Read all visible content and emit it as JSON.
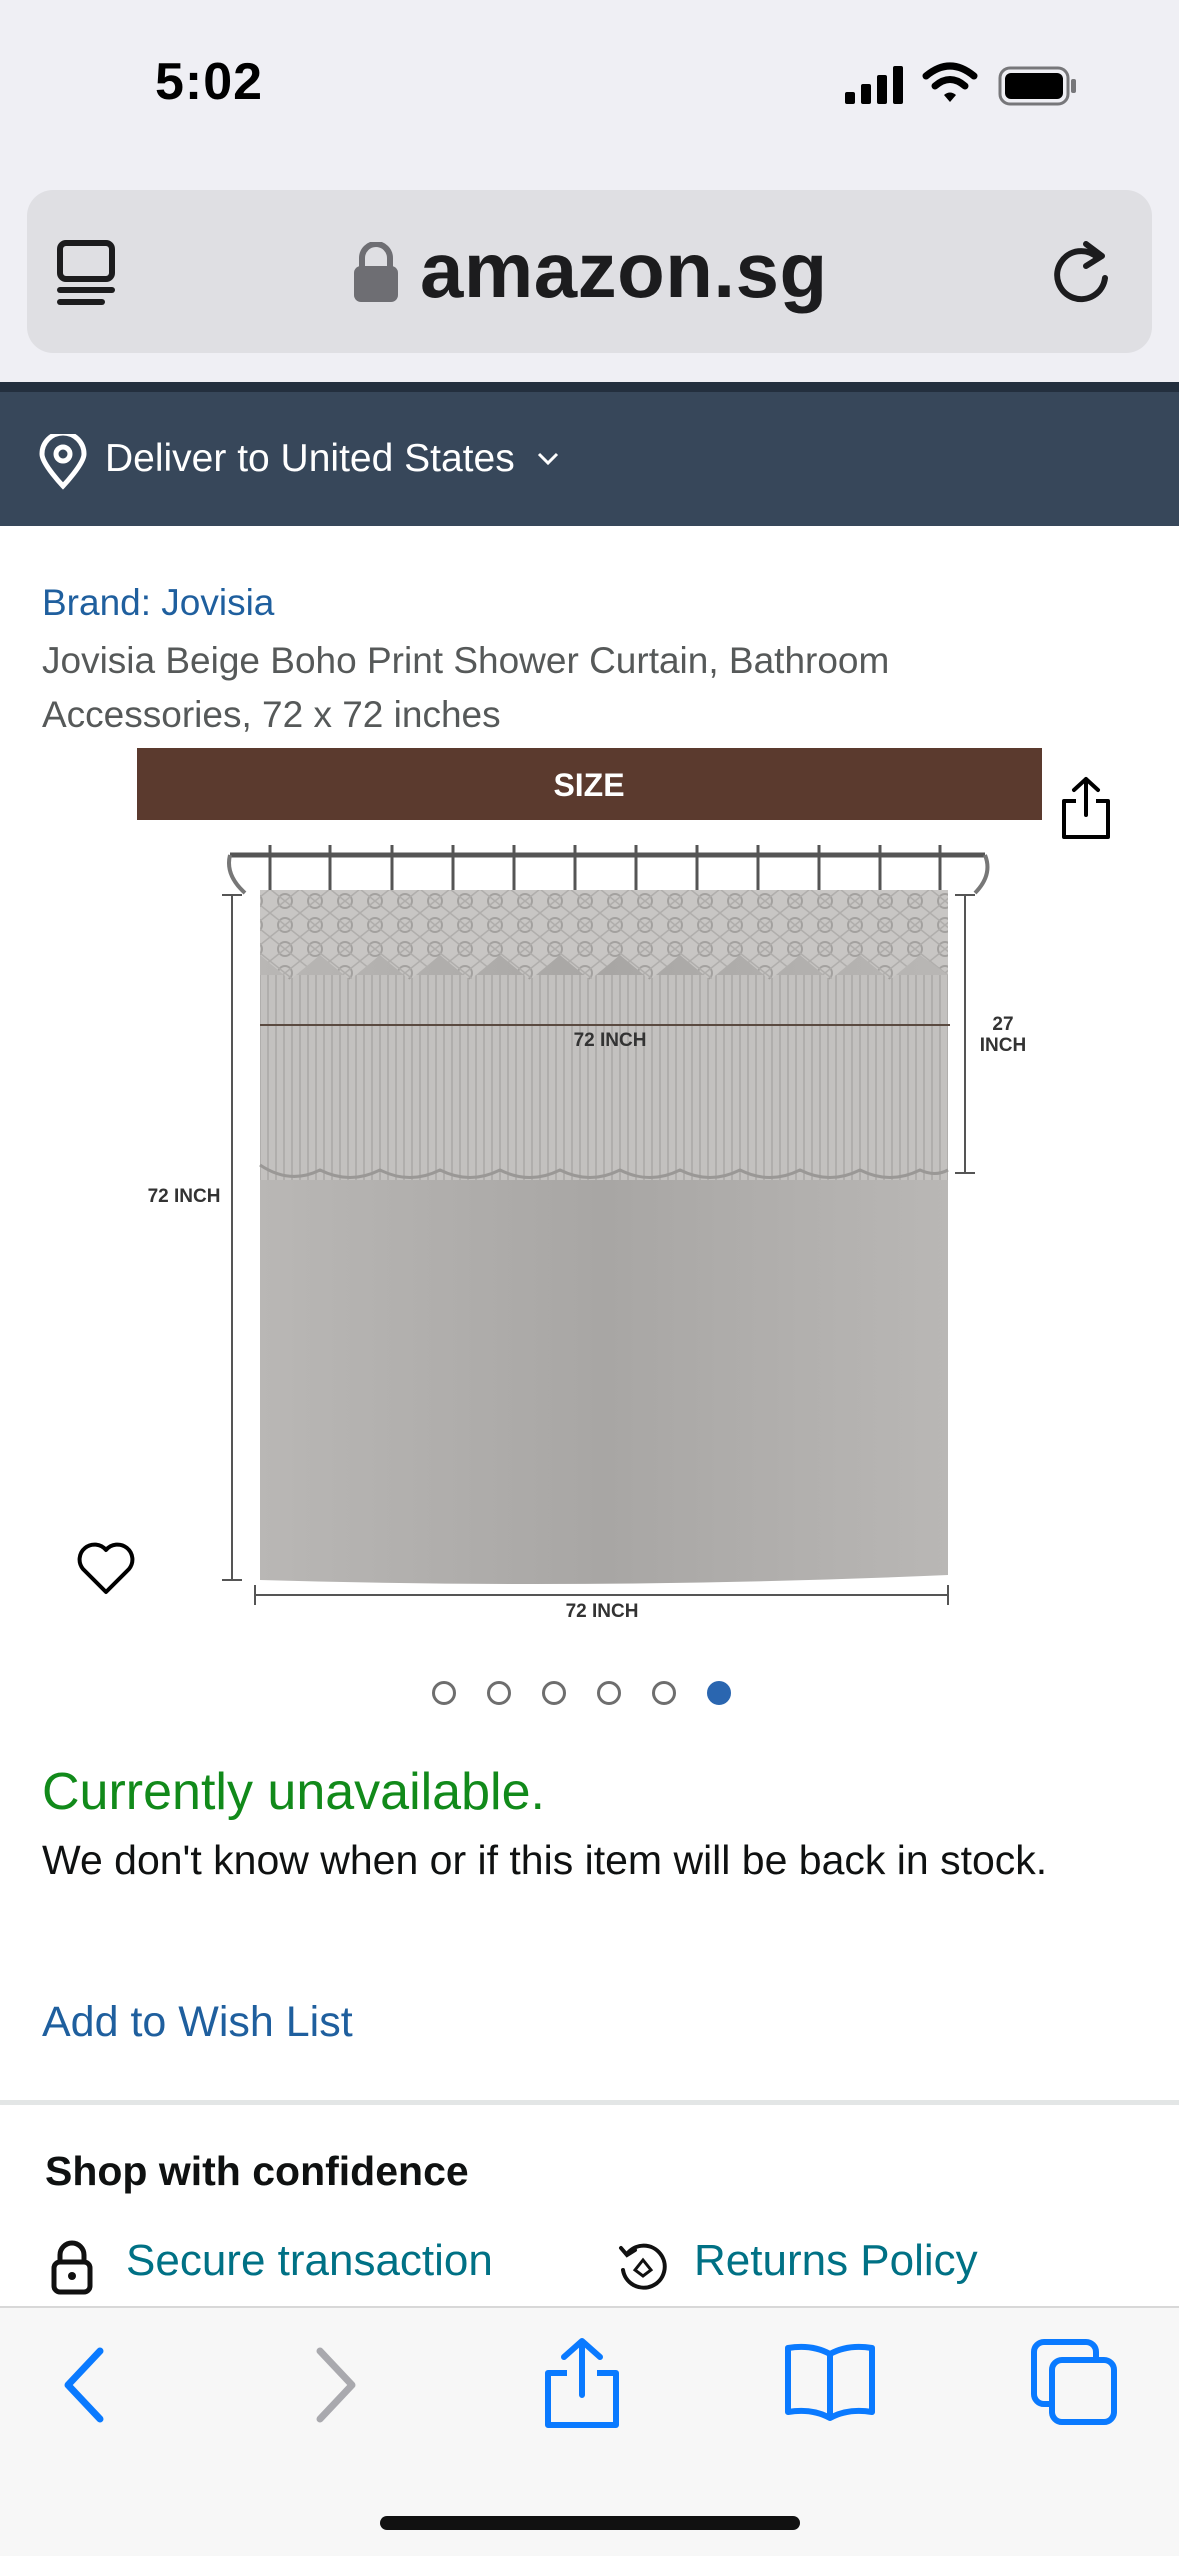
{
  "status_bar": {
    "time": "5:02"
  },
  "browser": {
    "domain": "amazon.sg"
  },
  "delivery": {
    "label": "Deliver to United States"
  },
  "product": {
    "brand": "Brand: Jovisia",
    "title": "Jovisia Beige Boho Print Shower Curtain, Bathroom Accessories, 72 x 72 inches",
    "image": {
      "banner": "SIZE",
      "width_top": "72 INCH",
      "height_left": "72 INCH",
      "valance_height_line1": "27",
      "valance_height_line2": "INCH",
      "width_bottom": "72 INCH"
    },
    "image_count": 6,
    "image_selected": 6
  },
  "availability": {
    "status": "Currently unavailable.",
    "note": "We don't know when or if this item will be back in stock.",
    "wishlist": "Add to Wish List"
  },
  "confidence": {
    "title": "Shop with confidence",
    "secure": "Secure transaction",
    "returns": "Returns Policy"
  },
  "colors": {
    "link": "#1f5f9e",
    "available_status": "#118a1a",
    "teal_link": "#007185",
    "nav_bar": "#37475a",
    "safari_blue": "#0a7aff"
  }
}
